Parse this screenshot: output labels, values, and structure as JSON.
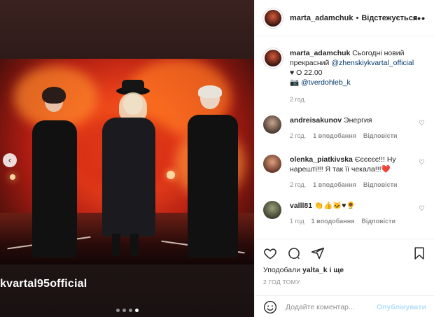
{
  "post": {
    "overlay_text": "kvartal95official",
    "carousel": {
      "count": 4,
      "active_index": 3
    }
  },
  "header": {
    "username": "marta_adamchuk",
    "separator": "•",
    "follow_label": "Відстежується",
    "more_label": "•••"
  },
  "caption": {
    "username": "marta_adamchuk",
    "text_part1": "Сьогодні новий прекрасний",
    "mention": "@zhenskiykvartal_official",
    "line2": "♥ О 22.00 ",
    "line3_icon": "📷",
    "line3_mention": "@tverdohleb_k",
    "time": "2 год."
  },
  "comments": [
    {
      "username": "andreisakunov",
      "text": "Энергия",
      "time": "2 год.",
      "likes": "1 вподобання",
      "reply": "Відповісти"
    },
    {
      "username": "olenka_piatkivska",
      "text": "Єєєєєє!!! Ну нарешті!!! Я так її чекала!!!",
      "emoji": "❤️",
      "time": "2 год.",
      "likes": "1 вподобання",
      "reply": "Відповісти"
    },
    {
      "username": "valll81",
      "text": "👏👍🐱♥🌻",
      "time": "1 год",
      "likes": "1 вподобання",
      "reply": "Відповісти"
    }
  ],
  "actions": {
    "likes_prefix": "Уподобали ",
    "likes_user": "yalta_k",
    "likes_suffix": " і ще",
    "ago": "2 ГОД ТОМУ",
    "comment_placeholder": "Додайте коментар...",
    "publish_label": "Опублікувати"
  },
  "icons": [
    "heart-icon",
    "comment-icon",
    "share-icon",
    "bookmark-icon",
    "smile-icon",
    "chevron-left-icon",
    "more-icon"
  ]
}
